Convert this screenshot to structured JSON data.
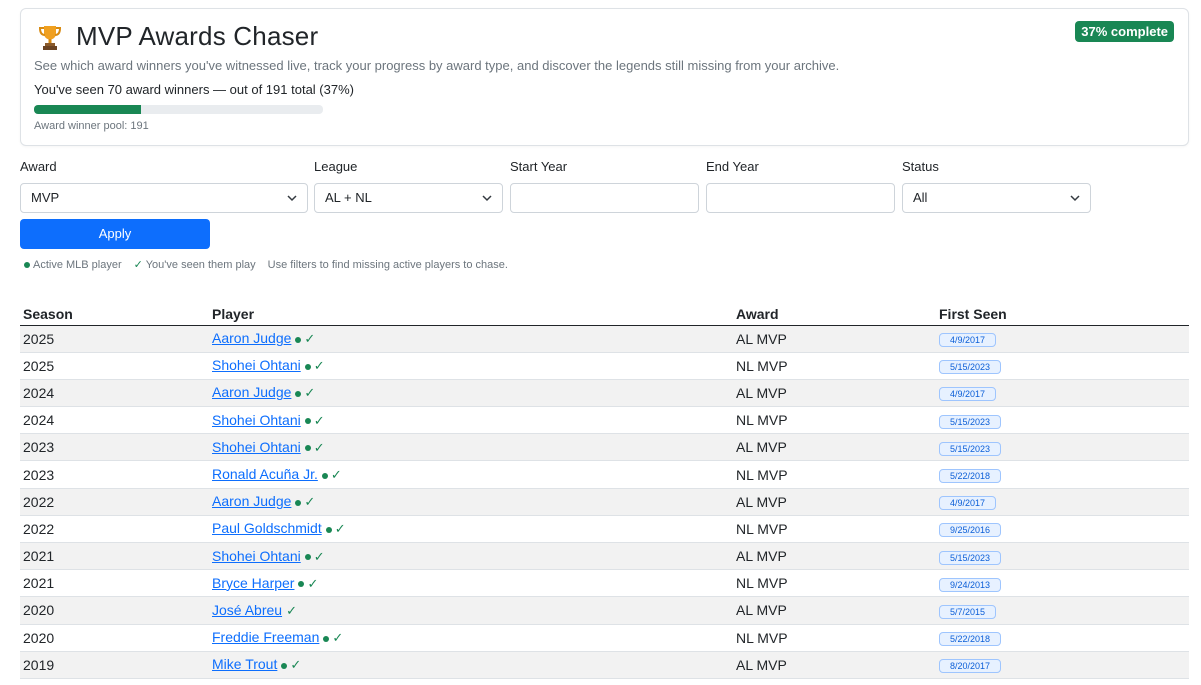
{
  "header": {
    "title": "MVP Awards Chaser",
    "badge": "37% complete",
    "description": "See which award winners you've witnessed live, track your progress by award type, and discover the legends still missing from your archive.",
    "seen_text": "You've seen 70 award winners — out of 191 total (37%)",
    "progress_fraction": 0.37,
    "pool_text": "Award winner pool: 191"
  },
  "filters": {
    "award_label": "Award",
    "award_value": "MVP",
    "league_label": "League",
    "league_value": "AL + NL",
    "start_year_label": "Start Year",
    "start_year_value": "",
    "end_year_label": "End Year",
    "end_year_value": "",
    "status_label": "Status",
    "status_value": "All",
    "apply_label": "Apply"
  },
  "legend": {
    "active_text": "Active MLB player",
    "seen_text": "You've seen them play",
    "hint_text": "Use filters to find missing active players to chase."
  },
  "table": {
    "headers": {
      "season": "Season",
      "player": "Player",
      "award": "Award",
      "first_seen": "First Seen"
    },
    "rows": [
      {
        "season": "2025",
        "player": "Aaron Judge",
        "award": "AL MVP",
        "first_seen": "4/9/2017",
        "active": true,
        "seen": true
      },
      {
        "season": "2025",
        "player": "Shohei Ohtani",
        "award": "NL MVP",
        "first_seen": "5/15/2023",
        "active": true,
        "seen": true
      },
      {
        "season": "2024",
        "player": "Aaron Judge",
        "award": "AL MVP",
        "first_seen": "4/9/2017",
        "active": true,
        "seen": true
      },
      {
        "season": "2024",
        "player": "Shohei Ohtani",
        "award": "NL MVP",
        "first_seen": "5/15/2023",
        "active": true,
        "seen": true
      },
      {
        "season": "2023",
        "player": "Shohei Ohtani",
        "award": "AL MVP",
        "first_seen": "5/15/2023",
        "active": true,
        "seen": true
      },
      {
        "season": "2023",
        "player": "Ronald Acuña Jr.",
        "award": "NL MVP",
        "first_seen": "5/22/2018",
        "active": true,
        "seen": true
      },
      {
        "season": "2022",
        "player": "Aaron Judge",
        "award": "AL MVP",
        "first_seen": "4/9/2017",
        "active": true,
        "seen": true
      },
      {
        "season": "2022",
        "player": "Paul Goldschmidt",
        "award": "NL MVP",
        "first_seen": "9/25/2016",
        "active": true,
        "seen": true
      },
      {
        "season": "2021",
        "player": "Shohei Ohtani",
        "award": "AL MVP",
        "first_seen": "5/15/2023",
        "active": true,
        "seen": true
      },
      {
        "season": "2021",
        "player": "Bryce Harper",
        "award": "NL MVP",
        "first_seen": "9/24/2013",
        "active": true,
        "seen": true
      },
      {
        "season": "2020",
        "player": "José Abreu",
        "award": "AL MVP",
        "first_seen": "5/7/2015",
        "active": false,
        "seen": true
      },
      {
        "season": "2020",
        "player": "Freddie Freeman",
        "award": "NL MVP",
        "first_seen": "5/22/2018",
        "active": true,
        "seen": true
      },
      {
        "season": "2019",
        "player": "Mike Trout",
        "award": "AL MVP",
        "first_seen": "8/20/2017",
        "active": true,
        "seen": true
      }
    ]
  },
  "colors": {
    "accent": "#0d6efd",
    "success": "#198754"
  },
  "icons": {
    "trophy": "trophy-icon",
    "chevron": "chevron-down-icon",
    "active": "active-dot-icon",
    "seen": "checkmark-icon"
  }
}
